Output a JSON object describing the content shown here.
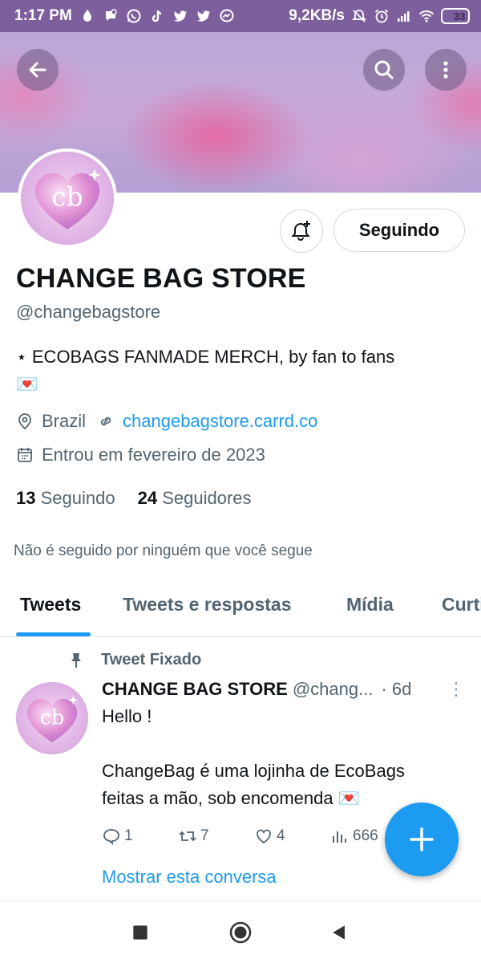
{
  "status_bar": {
    "time": "1:17 PM",
    "speed": "9,2KB/s",
    "battery": "33",
    "battery_level": 0.33,
    "icons": [
      "data-saver-icon",
      "chat-bubble-icon",
      "whatsapp-icon",
      "tiktok-icon",
      "twitter-icon",
      "twitter-icon",
      "messenger-icon",
      "mute-icon",
      "alarm-icon",
      "signal-icon",
      "wifi-icon",
      "battery-icon"
    ]
  },
  "header": {
    "back_icon": "arrow-left-icon",
    "search_icon": "search-icon",
    "more_icon": "more-vertical-icon"
  },
  "profile": {
    "avatar_text": "cb",
    "follow_button": "Seguindo",
    "name": "CHANGE BAG STORE",
    "handle": "@changebagstore",
    "bio_line1": "⋆ ECOBAGS FANMADE MERCH, by fan to fans",
    "bio_emoji": "💌",
    "location": "Brazil",
    "website": "changebagstore.carrd.co",
    "joined": "Entrou em fevereiro de 2023",
    "following_count": "13",
    "following_label": "Seguindo",
    "followers_count": "24",
    "followers_label": "Seguidores",
    "followed_by": "Não é seguido por ninguém que você segue"
  },
  "tabs": [
    {
      "label": "Tweets"
    },
    {
      "label": "Tweets e respostas"
    },
    {
      "label": "Mídia"
    },
    {
      "label": "Curtidas"
    }
  ],
  "pinned_tweet": {
    "pinned_label": "Tweet Fixado",
    "author_name": "CHANGE BAG STORE",
    "author_handle": "@chang...",
    "time": "· 6d",
    "more": "⋮",
    "text_line1": "Hello !",
    "text_line3": "ChangeBag é uma lojinha de EcoBags",
    "text_line4": "feitas a mão, sob encomenda 💌",
    "replies": "1",
    "retweets": "7",
    "likes": "4",
    "views": "666",
    "show_thread": "Mostrar esta conversa"
  },
  "colors": {
    "accent": "#1d9bf0",
    "status_bar": "#7e5f9d",
    "secondary_text": "#536471"
  }
}
